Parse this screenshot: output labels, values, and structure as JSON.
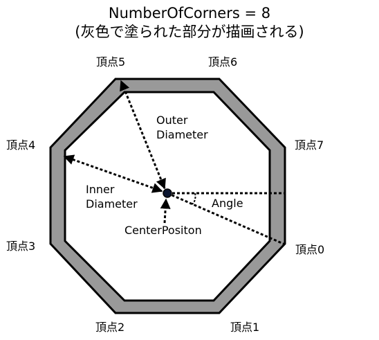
{
  "title": {
    "line1": "NumberOfCorners = 8",
    "line2": "(灰色で塗られた部分が描画される)"
  },
  "vertices": [
    "頂点0",
    "頂点1",
    "頂点2",
    "頂点3",
    "頂点4",
    "頂点5",
    "頂点6",
    "頂点7"
  ],
  "labels": {
    "outer_diameter": [
      "Outer",
      "Diameter"
    ],
    "inner_diameter": [
      "Inner",
      "Diameter"
    ],
    "center_position": "CenterPositon",
    "angle": "Angle"
  },
  "colors": {
    "ring_fill": "#999999",
    "stroke": "#000000",
    "background": "#ffffff"
  }
}
